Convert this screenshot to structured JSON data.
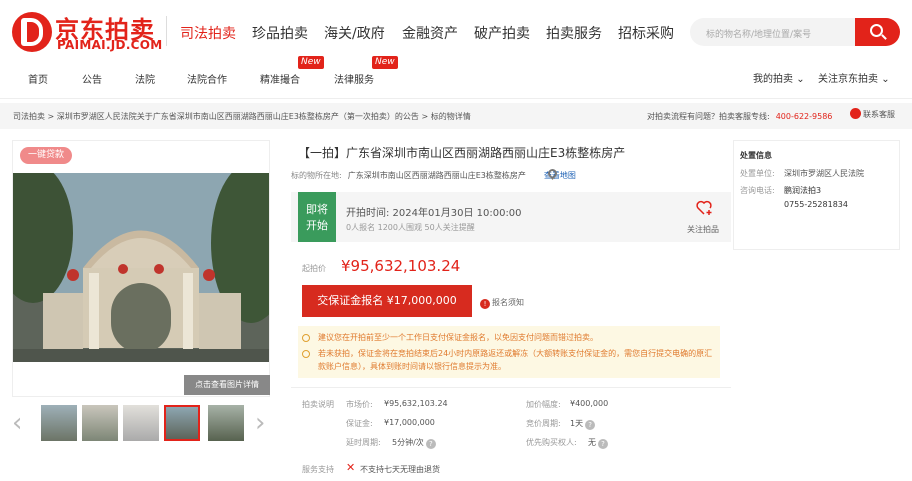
{
  "brand": {
    "name_cn": "京东拍卖",
    "name_en": "PAIMAI.JD.COM",
    "color": "#e2231a"
  },
  "main_nav": [
    "司法拍卖",
    "珍品拍卖",
    "海关/政府",
    "金融资产",
    "破产拍卖",
    "拍卖服务",
    "招标采购"
  ],
  "search": {
    "placeholder": "标的物名称/地理位置/案号",
    "icon": "search-icon"
  },
  "sub_nav": [
    "首页",
    "公告",
    "法院",
    "法院合作",
    "精准撮合",
    "法律服务"
  ],
  "new_badge": "New",
  "user_links": {
    "my_auction": "我的拍卖",
    "follow": "关注京东拍卖"
  },
  "breadcrumb": "司法拍卖 > 深圳市罗湖区人民法院关于广东省深圳市南山区西丽湖路西丽山庄E3栋整栋房产（第一次拍卖）的公告 > 标的物详情",
  "help": {
    "text": "对拍卖流程有问题？拍卖客服专线:",
    "phone": "400-622-9586",
    "contact": "联系客服"
  },
  "gallery": {
    "loan_badge": "一键贷款",
    "detail_button": "点击查看图片详情",
    "thumbnail_count": 5,
    "selected_index": 3
  },
  "item": {
    "title": "【一拍】广东省深圳市南山区西丽湖路西丽山庄E3栋整栋房产",
    "location_label": "标的物所在地:",
    "location": "广东深圳市南山区西丽湖路西丽山庄E3栋整栋房产",
    "map_link": "查看地图"
  },
  "status": {
    "badge_line1": "即将",
    "badge_line2": "开始",
    "start_time": "开拍时间:  2024年01月30日  10:00:00",
    "counts": "0人报名   1200人围观   50人关注提醒",
    "follow": "关注拍品"
  },
  "price": {
    "label": "起拍价",
    "value": "¥95,632,103.24"
  },
  "deposit_button": "交保证金报名 ¥17,000,000",
  "notice_link": "报名须知",
  "tips": [
    "建议您在开拍前至少一个工作日支付保证金报名，以免因支付问题而错过拍卖。",
    "若未获拍，保证金将在竞拍结束后24小时内原路返还或解冻（大额转账支付保证金的，需您自行提交电确的原汇款账户信息），具体到账时间请以银行信息提示为准。"
  ],
  "details": {
    "label": "拍卖说明",
    "market_price_label": "市场价:",
    "market_price": "¥95,632,103.24",
    "increment_label": "加价幅度:",
    "increment": "¥400,000",
    "deposit_label": "保证金:",
    "deposit": "¥17,000,000",
    "cycle_label": "竞价周期:",
    "cycle": "1天",
    "delay_label": "延时周期:",
    "delay": "5分钟/次",
    "priority_label": "优先购买权人:",
    "priority": "无"
  },
  "service": {
    "label": "服务支持",
    "text": "不支持七天无理由退货"
  },
  "disposal": {
    "heading": "处置信息",
    "unit_label": "处置单位:",
    "unit": "深圳市罗湖区人民法院",
    "phone_label": "咨询电话:",
    "contact_name": "鹏润法拍3",
    "phone": "0755-25281834"
  }
}
